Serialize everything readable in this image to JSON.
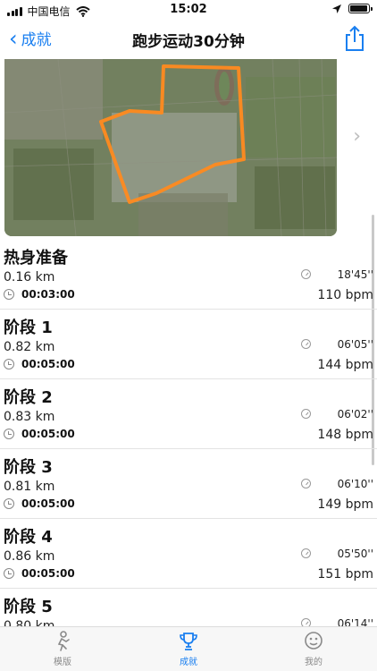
{
  "status_bar": {
    "carrier": "中国电信",
    "time": "15:02",
    "battery_level": 0.95
  },
  "nav": {
    "back_label": "成就",
    "title": "跑步运动30分钟",
    "share_icon": "share-icon"
  },
  "colors": {
    "accent": "#1a7ff0",
    "route": "#ff8a1f",
    "divider": "#e3e3e3"
  },
  "segments": [
    {
      "title": "热身准备",
      "distance": "0.16 km",
      "duration": "00:03:00",
      "pace": "18'45''",
      "bpm": "110 bpm"
    },
    {
      "title": "阶段 1",
      "distance": "0.82 km",
      "duration": "00:05:00",
      "pace": "06'05''",
      "bpm": "144 bpm"
    },
    {
      "title": "阶段 2",
      "distance": "0.83 km",
      "duration": "00:05:00",
      "pace": "06'02''",
      "bpm": "148 bpm"
    },
    {
      "title": "阶段 3",
      "distance": "0.81 km",
      "duration": "00:05:00",
      "pace": "06'10''",
      "bpm": "149 bpm"
    },
    {
      "title": "阶段 4",
      "distance": "0.86 km",
      "duration": "00:05:00",
      "pace": "05'50''",
      "bpm": "151 bpm"
    },
    {
      "title": "阶段 5",
      "distance": "0.80 km",
      "duration": "",
      "pace": "06'14''",
      "bpm": ""
    }
  ],
  "tabs": [
    {
      "label": "模版",
      "icon": "runner-icon",
      "active": false
    },
    {
      "label": "成就",
      "icon": "trophy-icon",
      "active": true
    },
    {
      "label": "我的",
      "icon": "face-icon",
      "active": false
    }
  ]
}
